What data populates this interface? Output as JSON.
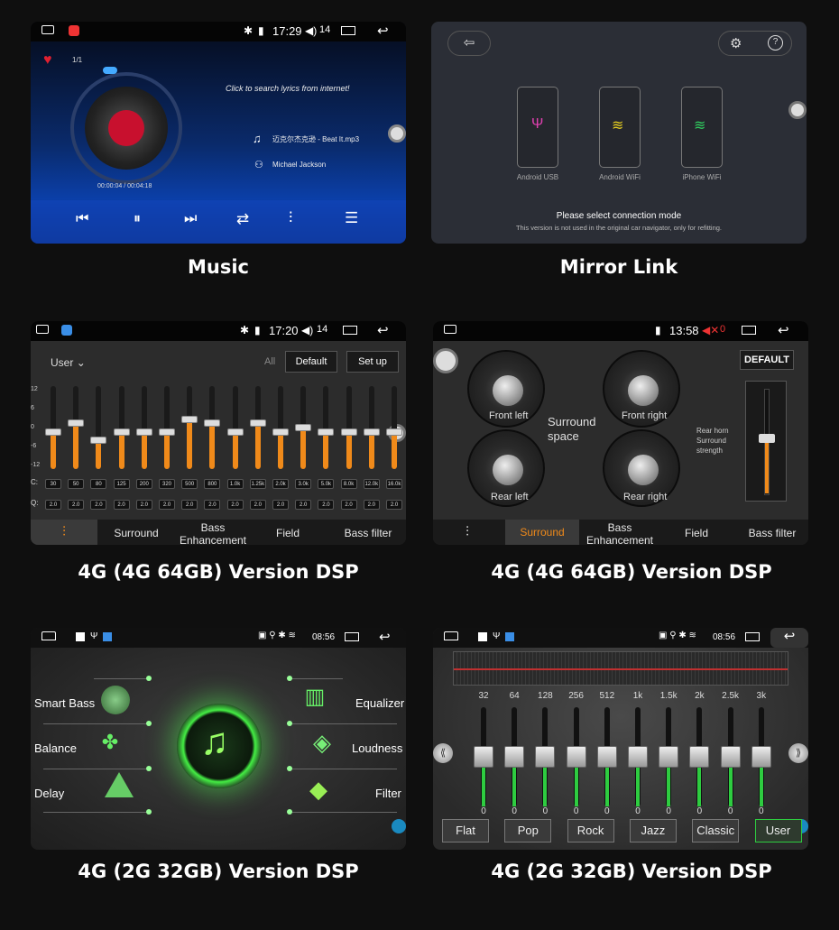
{
  "captions": {
    "music": "Music",
    "mirror": "Mirror Link",
    "dsp1": "4G (4G 64GB) Version DSP",
    "dsp2": "4G (4G 64GB) Version DSP",
    "dsp3": "4G (2G 32GB) Version DSP",
    "dsp4": "4G (2G 32GB) Version DSP"
  },
  "music": {
    "time": "17:29",
    "volume": "14",
    "track_index": "1/1",
    "lyrics_hint": "Click to search lyrics from internet!",
    "song": "迈克尔杰克逊 - Beat It.mp3",
    "artist": "Michael Jackson",
    "progress_time": "00:00:04 / 00:04:18",
    "progress": 0.016
  },
  "mirror": {
    "devices": [
      {
        "label": "Android USB"
      },
      {
        "label": "Android WiFi"
      },
      {
        "label": "iPhone WiFi"
      }
    ],
    "prompt": "Please select connection mode",
    "note": "This version is not used in the original car navigator, only for refitting."
  },
  "dsp1": {
    "time": "17:20",
    "volume": "14",
    "preset": "User",
    "all_label": "All",
    "default_btn": "Default",
    "setup_btn": "Set up",
    "scale": [
      "12",
      "6",
      "0",
      "-6",
      "-12"
    ],
    "row_c": "C:",
    "row_q": "Q:",
    "freqs": [
      "30",
      "50",
      "80",
      "125",
      "200",
      "320",
      "500",
      "800",
      "1.0k",
      "1.25k",
      "2.0k",
      "3.0k",
      "5.0k",
      "8.0k",
      "12.0k",
      "16.0k"
    ],
    "qvals": [
      "2.0",
      "2.0",
      "2.0",
      "2.0",
      "2.0",
      "2.0",
      "2.0",
      "2.0",
      "2.0",
      "2.0",
      "2.0",
      "2.0",
      "2.0",
      "2.0",
      "2.0",
      "2.0"
    ],
    "levels": [
      0.45,
      0.55,
      0.35,
      0.45,
      0.45,
      0.45,
      0.6,
      0.55,
      0.45,
      0.55,
      0.45,
      0.5,
      0.45,
      0.45,
      0.45,
      0.45
    ],
    "tabs": [
      "Surround",
      "Bass Enhancement",
      "Field",
      "Bass filter"
    ]
  },
  "dsp2": {
    "time": "13:58",
    "volume": "0",
    "default_btn": "DEFAULT",
    "dials": [
      "Front left",
      "Front right",
      "Rear left",
      "Rear right"
    ],
    "center_label": "Surround space",
    "side_label": "Rear horn Surround strength",
    "tabs": [
      "Surround",
      "Bass Enhancement",
      "Field",
      "Bass filter"
    ]
  },
  "dsp3": {
    "time": "08:56",
    "left_items": [
      "Smart Bass",
      "Balance",
      "Delay"
    ],
    "right_items": [
      "Equalizer",
      "Loudness",
      "Filter"
    ]
  },
  "dsp4": {
    "time": "08:56",
    "freqs": [
      "32",
      "64",
      "128",
      "256",
      "512",
      "1k",
      "1.5k",
      "2k",
      "2.5k",
      "3k"
    ],
    "values": [
      "0",
      "0",
      "0",
      "0",
      "0",
      "0",
      "0",
      "0",
      "0",
      "0"
    ],
    "presets": [
      "Flat",
      "Pop",
      "Rock",
      "Jazz",
      "Classic",
      "User"
    ],
    "active_preset": "User"
  },
  "colors": {
    "accent_orange": "#f08a1a",
    "accent_green": "#2ecc40",
    "music_blue": "#0b3fa8"
  }
}
